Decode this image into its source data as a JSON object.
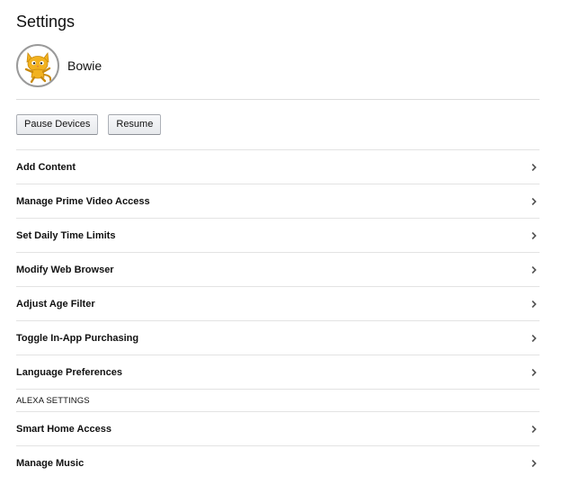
{
  "page": {
    "title": "Settings"
  },
  "profile": {
    "name": "Bowie",
    "avatar_icon": "cat-avatar-icon"
  },
  "actions": {
    "pause_label": "Pause Devices",
    "resume_label": "Resume"
  },
  "settings": {
    "items": [
      {
        "label": "Add Content"
      },
      {
        "label": "Manage Prime Video Access"
      },
      {
        "label": "Set Daily Time Limits"
      },
      {
        "label": "Modify Web Browser"
      },
      {
        "label": "Adjust Age Filter"
      },
      {
        "label": "Toggle In-App Purchasing"
      },
      {
        "label": "Language Preferences"
      }
    ],
    "alexa_heading": "ALEXA SETTINGS",
    "alexa_items": [
      {
        "label": "Smart Home Access"
      },
      {
        "label": "Manage Music"
      }
    ]
  },
  "icons": {
    "row_chevron": "chevron-right-icon"
  },
  "colors": {
    "divider": "#e3e3e3",
    "button_bg": "#e7e9ec",
    "avatar_ring": "#9a9a9a",
    "cat": "#f2b21f"
  }
}
